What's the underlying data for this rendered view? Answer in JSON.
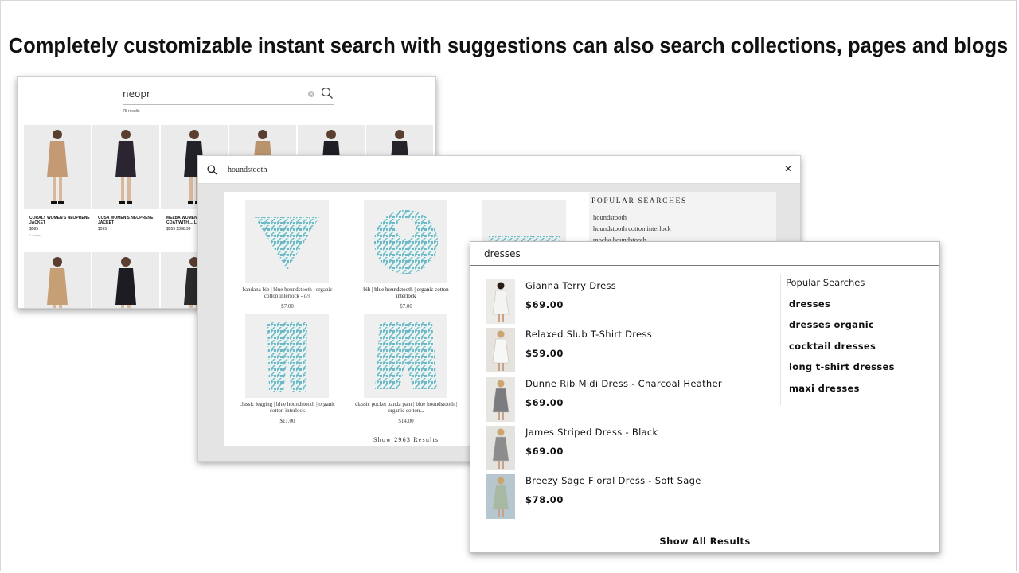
{
  "headline": "Completely customizable instant search with suggestions can also search collections, pages and blogs",
  "shot1": {
    "query": "neopr",
    "clear_icon": "×",
    "results_count": "75 results",
    "products": [
      {
        "name": "CORALY WOMEN'S NEOPRENE JACKET",
        "price": "$585",
        "note": "2 colors",
        "coat": "#c39a74"
      },
      {
        "name": "COSA WOMEN'S NEOPRENE JACKET",
        "price": "$595",
        "note": "",
        "coat": "#2a2530"
      },
      {
        "name": "MELBA WOMEN'S ... WRAP COAT WITH ... LEATHER SLEEVE",
        "price": "$555  $388.99",
        "note": "",
        "coat": "#232327"
      },
      {
        "name": "",
        "price": "",
        "note": "",
        "coat": "#b9936c"
      },
      {
        "name": "",
        "price": "",
        "note": "",
        "coat": "#1e1e24"
      },
      {
        "name": "",
        "price": "",
        "note": "",
        "coat": "#26232b"
      },
      {
        "name": "",
        "price": "",
        "note": "",
        "coat": "#c79f74"
      },
      {
        "name": "",
        "price": "",
        "note": "",
        "coat": "#1d1c22"
      },
      {
        "name": "",
        "price": "",
        "note": "",
        "coat": "#2b2b2b"
      }
    ]
  },
  "shot2": {
    "query": "houndstooth",
    "close_icon": "✕",
    "products": [
      {
        "title": "bandana bib | blue houndstooth | organic cotton interlock - o/s",
        "price": "$7.00",
        "bold": false
      },
      {
        "title": "bib | blue houndstooth | organic cotton interlock",
        "price": "$7.00",
        "bold": true
      },
      {
        "title": "",
        "price": "",
        "bold": false
      },
      {
        "title": "classic legging | blue houndstooth | organic cotton interlock",
        "price": "$11.00",
        "bold": false
      },
      {
        "title": "classic pocket panda pant | blue houndstooth | organic cotton...",
        "price": "$14.00",
        "bold": false
      }
    ],
    "show_results": "Show 2963 Results",
    "popular_heading": "POPULAR SEARCHES",
    "popular": [
      "houndstooth",
      "houndstooth cotton interlock",
      "mocha houndstooth"
    ]
  },
  "shot3": {
    "query": "dresses",
    "products": [
      {
        "name": "Gianna Terry Dress",
        "price": "$69.00",
        "color": "#f4f4f2",
        "bg": "#ecebe8"
      },
      {
        "name": "Relaxed Slub T-Shirt Dress",
        "price": "$59.00",
        "color": "#f7f7f5",
        "bg": "#e6e2de"
      },
      {
        "name": "Dunne Rib Midi Dress - Charcoal Heather",
        "price": "$69.00",
        "color": "#7b7c80",
        "bg": "#e8e6e2"
      },
      {
        "name": "James Striped Dress - Black",
        "price": "$69.00",
        "color": "#8c8c8c",
        "bg": "#e4e2df"
      },
      {
        "name": "Breezy Sage Floral Dress - Soft Sage",
        "price": "$78.00",
        "color": "#a8b9a3",
        "bg": "#b7c7cf"
      }
    ],
    "popular_heading": "Popular Searches",
    "popular": [
      "dresses",
      "dresses organic",
      "cocktail dresses",
      "long t-shirt dresses",
      "maxi dresses"
    ],
    "show_all": "Show All Results"
  }
}
